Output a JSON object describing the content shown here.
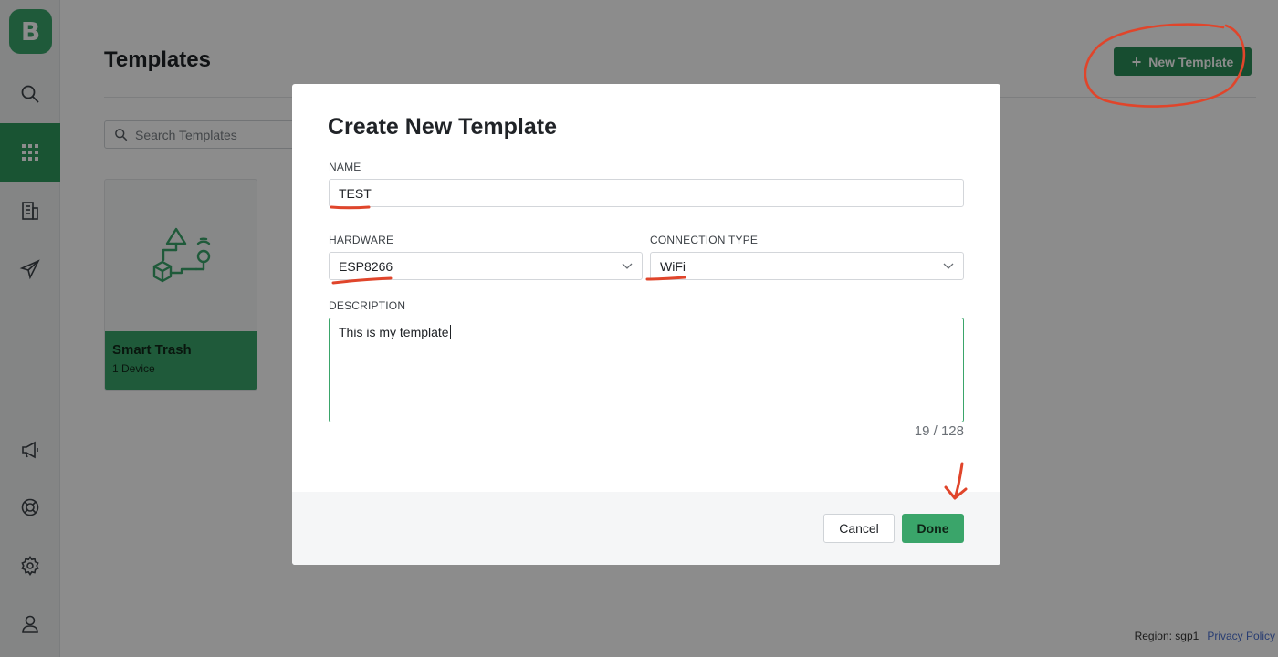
{
  "app": {
    "logo_letter": "B"
  },
  "sidebar": {
    "items": [
      {
        "icon": "search-icon",
        "active": false
      },
      {
        "icon": "grid-icon",
        "active": true
      },
      {
        "icon": "building-icon",
        "active": false
      },
      {
        "icon": "send-icon",
        "active": false
      },
      {
        "icon": "megaphone-icon",
        "active": false
      },
      {
        "icon": "lifebuoy-icon",
        "active": false
      },
      {
        "icon": "gear-icon",
        "active": false
      },
      {
        "icon": "user-icon",
        "active": false
      }
    ]
  },
  "page": {
    "title": "Templates",
    "new_template_label": "New Template",
    "search_placeholder": "Search Templates"
  },
  "templates": [
    {
      "title": "Smart Trash",
      "subtitle": "1 Device"
    }
  ],
  "footer": {
    "region": "Region: sgp1",
    "privacy": "Privacy Policy"
  },
  "modal": {
    "title": "Create New Template",
    "name_label": "NAME",
    "name_value": "TEST",
    "hardware_label": "HARDWARE",
    "hardware_value": "ESP8266",
    "connection_label": "CONNECTION TYPE",
    "connection_value": "WiFi",
    "description_label": "DESCRIPTION",
    "description_value": "This is my template",
    "counter": "19 / 128",
    "cancel_label": "Cancel",
    "done_label": "Done"
  },
  "colors": {
    "brand_green": "#3aa56a",
    "dark_green": "#2b8c58",
    "annotation_red": "#e0452b"
  }
}
